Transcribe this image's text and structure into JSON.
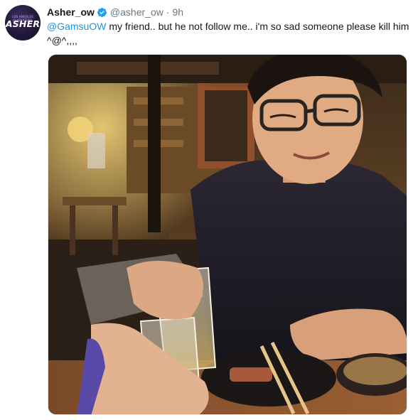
{
  "tweet": {
    "author_name": "Asher_ow",
    "author_handle": "@asher_ow",
    "separator": "·",
    "timestamp": "9h",
    "mention": "@GamsuOW",
    "body": " my friend.. but he not follow me.. i'm so sad someone please kill him ^@^,,,,",
    "verified": true
  },
  "avatar": {
    "small_text": "LOS ANGELES GLADIATORS",
    "big_text": "ASHER"
  },
  "media": {
    "description": "photo"
  },
  "colors": {
    "link": "#1b95e0",
    "secondary": "#657786",
    "verified": "#1da1f2"
  }
}
